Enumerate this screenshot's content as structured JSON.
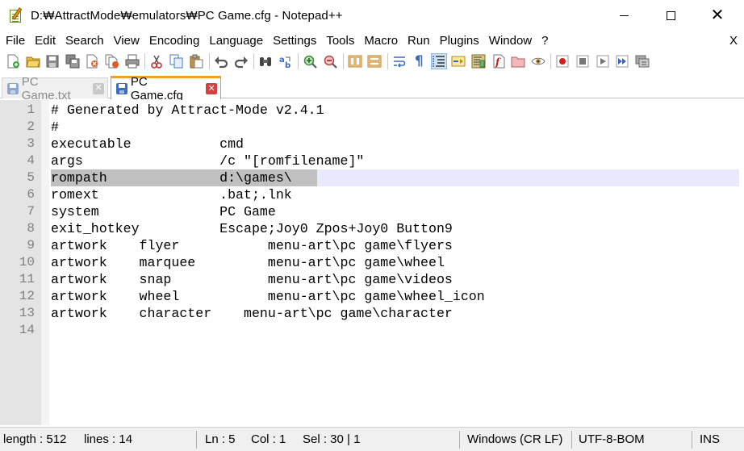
{
  "window": {
    "title": "D:₩AttractMode₩emulators₩PC Game.cfg - Notepad++"
  },
  "menu": {
    "items": [
      "File",
      "Edit",
      "Search",
      "View",
      "Encoding",
      "Language",
      "Settings",
      "Tools",
      "Macro",
      "Run",
      "Plugins",
      "Window",
      "?"
    ],
    "close_label": "X"
  },
  "tabs": [
    {
      "label": "PC Game.txt",
      "active": false
    },
    {
      "label": "PC Game.cfg",
      "active": true
    }
  ],
  "editor": {
    "current_line": 5,
    "lines": [
      {
        "num": "1",
        "text": "# Generated by Attract-Mode v2.4.1"
      },
      {
        "num": "2",
        "text": "#"
      },
      {
        "num": "3",
        "text": "executable           cmd"
      },
      {
        "num": "4",
        "text": "args                 /c \"[romfilename]\""
      },
      {
        "num": "5",
        "text": "rompath              d:\\games\\"
      },
      {
        "num": "6",
        "text": "romext               .bat;.lnk"
      },
      {
        "num": "7",
        "text": "system               PC Game"
      },
      {
        "num": "8",
        "text": "exit_hotkey          Escape;Joy0 Zpos+Joy0 Button9"
      },
      {
        "num": "9",
        "text": "artwork    flyer           menu-art\\pc game\\flyers"
      },
      {
        "num": "10",
        "text": "artwork    marquee         menu-art\\pc game\\wheel"
      },
      {
        "num": "11",
        "text": "artwork    snap            menu-art\\pc game\\videos"
      },
      {
        "num": "12",
        "text": "artwork    wheel           menu-art\\pc game\\wheel_icon"
      },
      {
        "num": "13",
        "text": "artwork    character    menu-art\\pc game\\character"
      },
      {
        "num": "14",
        "text": ""
      }
    ]
  },
  "status": {
    "length": "length : 512",
    "lines": "lines : 14",
    "ln": "Ln : 5",
    "col": "Col : 1",
    "sel": "Sel : 30 | 1",
    "eol": "Windows (CR LF)",
    "encoding": "UTF-8-BOM",
    "mode": "INS"
  },
  "colors": {
    "current_line": "#e8e8ff",
    "selection": "#c0c0c0",
    "active_tab_accent": "#f0a030",
    "gutter": "#e4e4e4"
  }
}
